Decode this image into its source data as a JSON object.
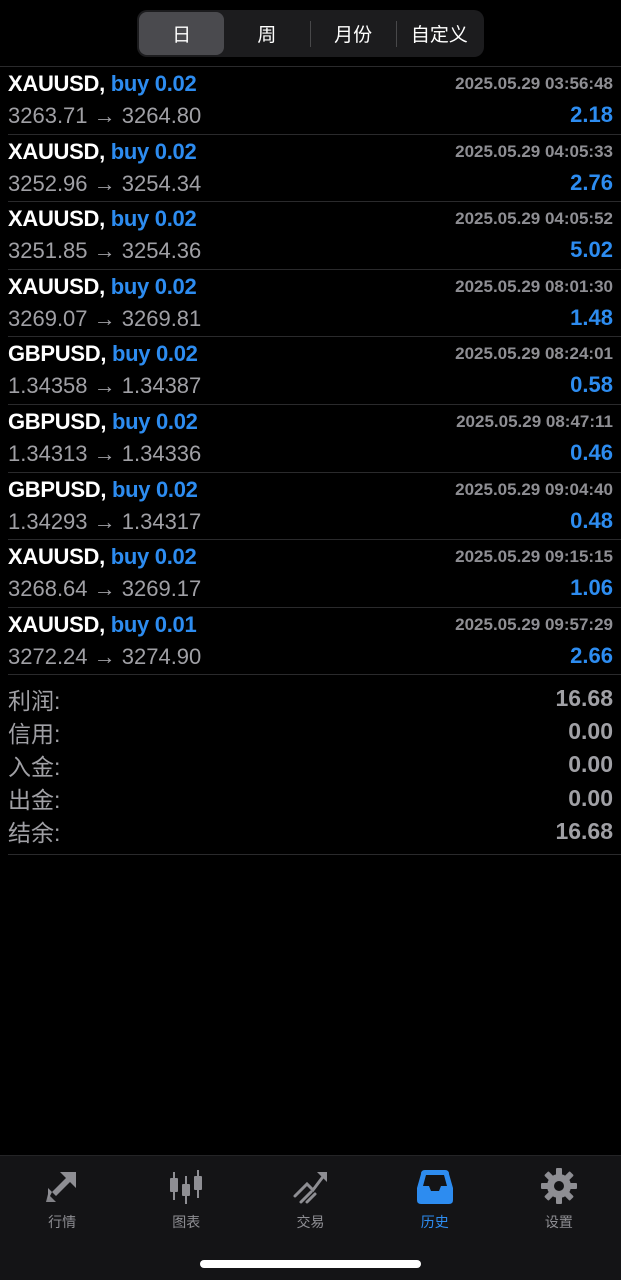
{
  "period_tabs": [
    {
      "label": "日",
      "active": true
    },
    {
      "label": "周",
      "active": false
    },
    {
      "label": "月份",
      "active": false
    },
    {
      "label": "自定义",
      "active": false
    }
  ],
  "trades": [
    {
      "symbol": "XAUUSD,",
      "side": "buy 0.02",
      "time": "2025.05.29 03:56:48",
      "prices": "3263.71 → 3264.80",
      "profit": "2.18"
    },
    {
      "symbol": "XAUUSD,",
      "side": "buy 0.02",
      "time": "2025.05.29 04:05:33",
      "prices": "3252.96 → 3254.34",
      "profit": "2.76"
    },
    {
      "symbol": "XAUUSD,",
      "side": "buy 0.02",
      "time": "2025.05.29 04:05:52",
      "prices": "3251.85 → 3254.36",
      "profit": "5.02"
    },
    {
      "symbol": "XAUUSD,",
      "side": "buy 0.02",
      "time": "2025.05.29 08:01:30",
      "prices": "3269.07 → 3269.81",
      "profit": "1.48"
    },
    {
      "symbol": "GBPUSD,",
      "side": "buy 0.02",
      "time": "2025.05.29 08:24:01",
      "prices": "1.34358 → 1.34387",
      "profit": "0.58"
    },
    {
      "symbol": "GBPUSD,",
      "side": "buy 0.02",
      "time": "2025.05.29 08:47:11",
      "prices": "1.34313 → 1.34336",
      "profit": "0.46"
    },
    {
      "symbol": "GBPUSD,",
      "side": "buy 0.02",
      "time": "2025.05.29 09:04:40",
      "prices": "1.34293 → 1.34317",
      "profit": "0.48"
    },
    {
      "symbol": "XAUUSD,",
      "side": "buy 0.02",
      "time": "2025.05.29 09:15:15",
      "prices": "3268.64 → 3269.17",
      "profit": "1.06"
    },
    {
      "symbol": "XAUUSD,",
      "side": "buy 0.01",
      "time": "2025.05.29 09:57:29",
      "prices": "3272.24 → 3274.90",
      "profit": "2.66"
    }
  ],
  "summary": [
    {
      "label": "利润:",
      "value": "16.68"
    },
    {
      "label": "信用:",
      "value": "0.00"
    },
    {
      "label": "入金:",
      "value": "0.00"
    },
    {
      "label": "出金:",
      "value": "0.00"
    },
    {
      "label": "结余:",
      "value": "16.68"
    }
  ],
  "tabbar": [
    {
      "label": "行情",
      "icon": "quotes-arrows-icon",
      "active": false
    },
    {
      "label": "图表",
      "icon": "candlestick-chart-icon",
      "active": false
    },
    {
      "label": "交易",
      "icon": "trade-trend-icon",
      "active": false
    },
    {
      "label": "历史",
      "icon": "history-inbox-icon",
      "active": true
    },
    {
      "label": "设置",
      "icon": "settings-gear-icon",
      "active": false
    }
  ],
  "colors": {
    "accent": "#2d8cf0",
    "background": "#000000",
    "secondary_text": "#a0a0a5",
    "inactive_icon": "#8e8e93"
  }
}
